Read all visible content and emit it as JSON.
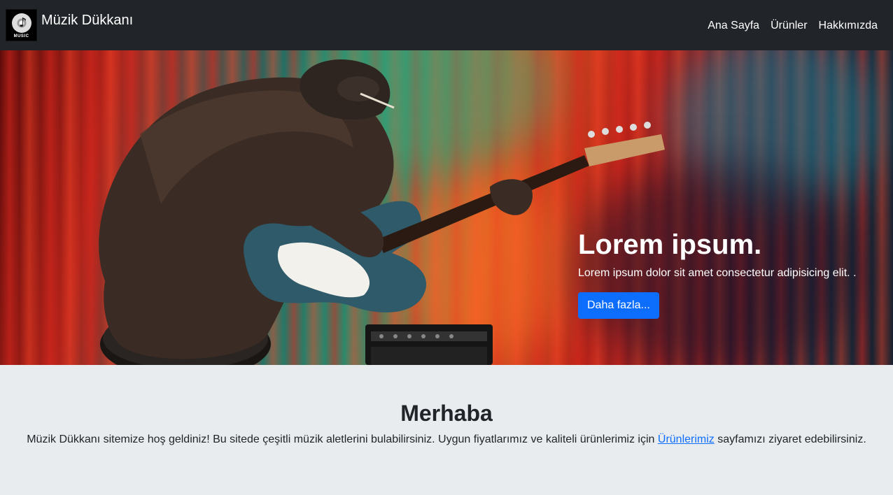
{
  "navbar": {
    "logo_text": "MUSIC",
    "brand": "Müzik Dükkanı",
    "links": [
      {
        "label": "Ana Sayfa"
      },
      {
        "label": "Ürünler"
      },
      {
        "label": "Hakkımızda"
      }
    ]
  },
  "hero": {
    "title": "Lorem ipsum.",
    "text": "Lorem ipsum dolor sit amet consectetur adipisicing elit. .",
    "button": "Daha fazla..."
  },
  "welcome": {
    "title": "Merhaba",
    "text_before": "Müzik Dükkanı sitemize hoş geldiniz! Bu sitede çeşitli müzik aletlerini bulabilirsiniz. Uygun fiyatlarımız ve kaliteli ürünlerimiz için ",
    "link": "Ürünlerimiz",
    "text_after": " sayfamızı ziyaret edebilirsiniz."
  },
  "colors": {
    "navbar_bg": "#212529",
    "primary": "#0d6efd",
    "page_bg": "#e9ecef"
  }
}
